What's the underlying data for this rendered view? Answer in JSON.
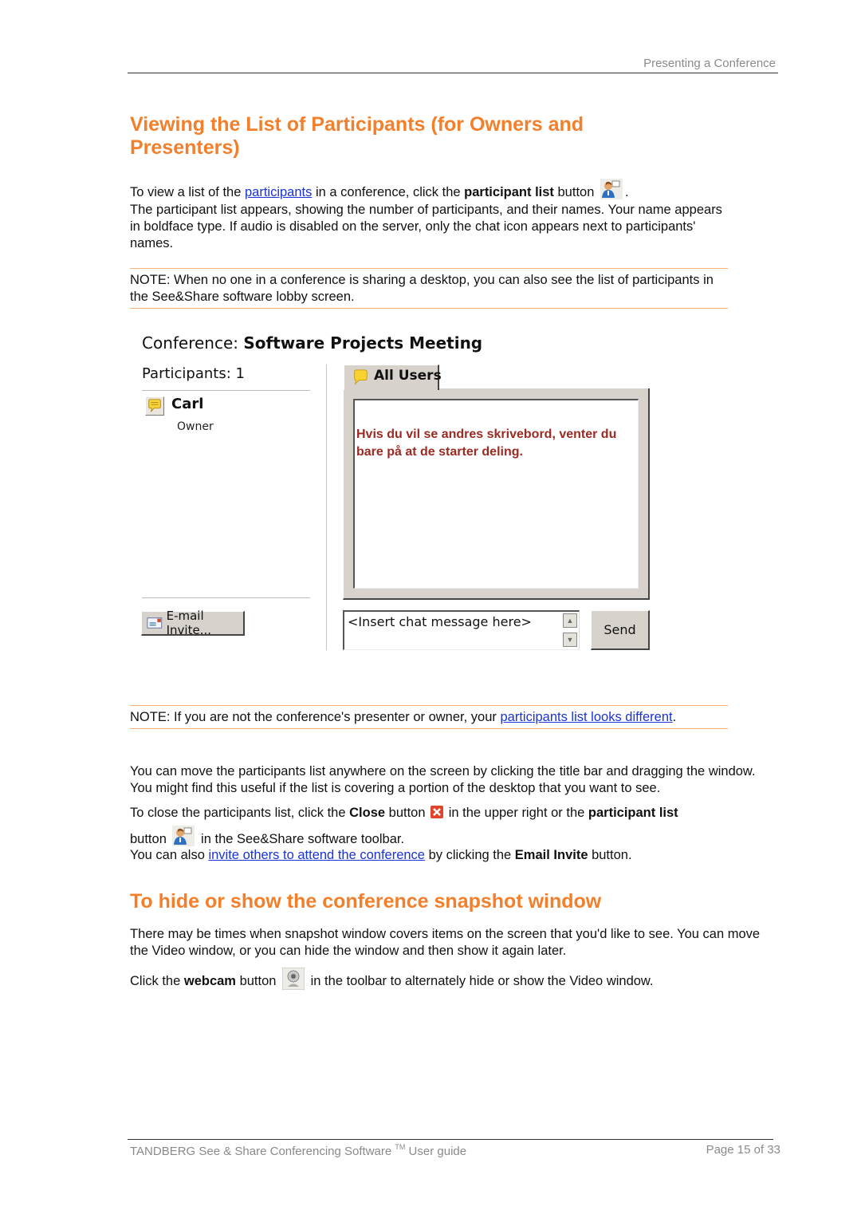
{
  "running_header": "Presenting a Conference",
  "section1": {
    "title_line1": "Viewing the List of Participants (for Owners and",
    "title_line2": "Presenters)",
    "para1": {
      "before_link": "To view a list of the ",
      "link": "participants",
      "middle": " in a conference, click the ",
      "bold": "participant list",
      "after": " button",
      "icon": "participant-list-icon",
      "end": "."
    },
    "para2": "The participant list appears, showing the number of participants, and their names. Your name appears in boldface type. If audio is disabled on the server, only the chat icon appears next to participants' names.",
    "note1": "NOTE: When no one in a conference is sharing a desktop, you can also see the list of participants in the See&Share software lobby screen."
  },
  "screenshot": {
    "conference_label": "Conference: ",
    "conference_name": "Software Projects Meeting",
    "participants_label": "Participants: 1",
    "participants": [
      {
        "name": "Carl",
        "role": "Owner",
        "icon": "chat-bubble-icon"
      }
    ],
    "tab_label": "All Users",
    "chat_message": "Hvis du vil se andres skrivebord, venter du bare på at de starter deling.",
    "email_invite_label": "E-mail Invite...",
    "chat_input_placeholder": "<Insert chat message here>",
    "send_label": "Send"
  },
  "note2": {
    "before_link": "NOTE: If you are not the conference's presenter or owner, your ",
    "link": "participants list looks different",
    "after": "."
  },
  "para3": "You can move the participants list anywhere on the screen by clicking the title bar and dragging the window. You might find this useful if the list is covering a portion of the desktop that you want to see.",
  "para4": {
    "t1": "To close the participants list, click the ",
    "b1": "Close",
    "t2": " button",
    "t3": " in the upper right or the ",
    "b2": "participant list",
    "t4": "button",
    "t5": " in the See&Share software toolbar."
  },
  "para5": {
    "t1": "You can also ",
    "link": "invite others to attend the conference",
    "t2": " by clicking the ",
    "b1": "Email Invite",
    "t3": " button."
  },
  "section2": {
    "title": "To hide or show the conference snapshot window",
    "para1": "There may be times when snapshot window covers items on the screen that you'd like to see. You can move the Video window, or you can hide the window and then show it again later.",
    "para2": {
      "t1": "Click the ",
      "b1": "webcam",
      "t2": " button",
      "t3": " in the toolbar to alternately hide or show the Video window."
    }
  },
  "footer": {
    "left_main": "TANDBERG See & Share Conferencing Software ",
    "left_tm": "TM",
    "left_end": " User guide",
    "right": "Page 15 of 33"
  },
  "colors": {
    "heading_orange": "#f47f2a",
    "link_blue": "#1a33d8",
    "note_rule": "#f6b27a",
    "chat_text": "#9b2a22"
  }
}
